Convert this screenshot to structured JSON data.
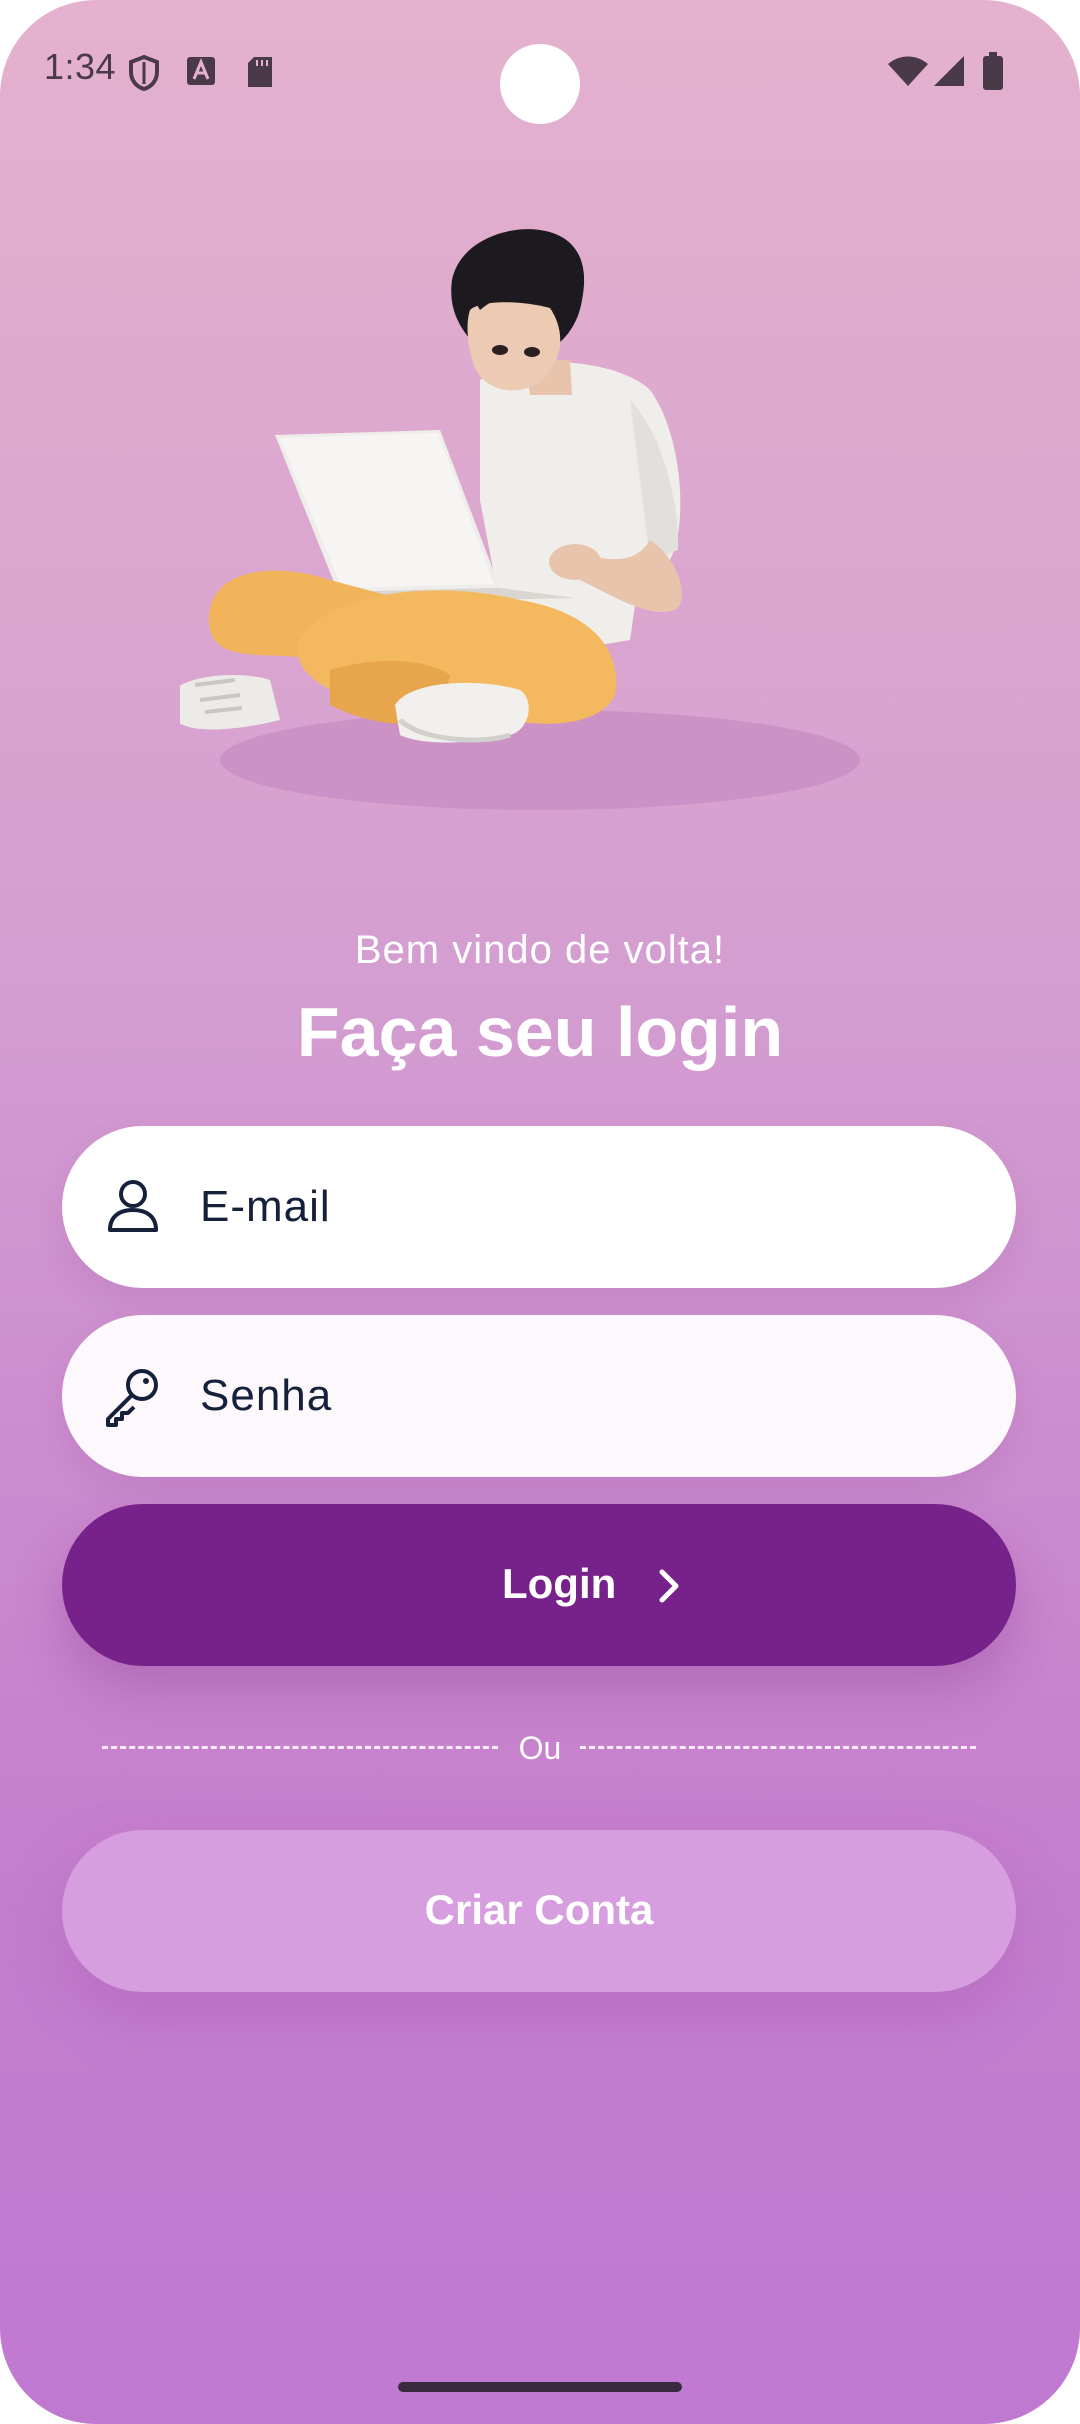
{
  "status_bar": {
    "time": "1:34",
    "icons": [
      "shield-icon",
      "font-a-icon",
      "sd-card-icon",
      "wifi-icon",
      "signal-icon",
      "battery-icon"
    ]
  },
  "login": {
    "welcome": "Bem vindo de volta!",
    "title": "Faça seu login",
    "email_placeholder": "E-mail",
    "password_placeholder": "Senha",
    "login_label": "Login",
    "divider_label": "Ou",
    "create_account_label": "Criar Conta"
  },
  "colors": {
    "background_top": "#e4b2ce",
    "background_bottom": "#c079d1",
    "primary_button": "#76228a",
    "secondary_button": "#d69ddf",
    "input_text": "#15213b"
  }
}
